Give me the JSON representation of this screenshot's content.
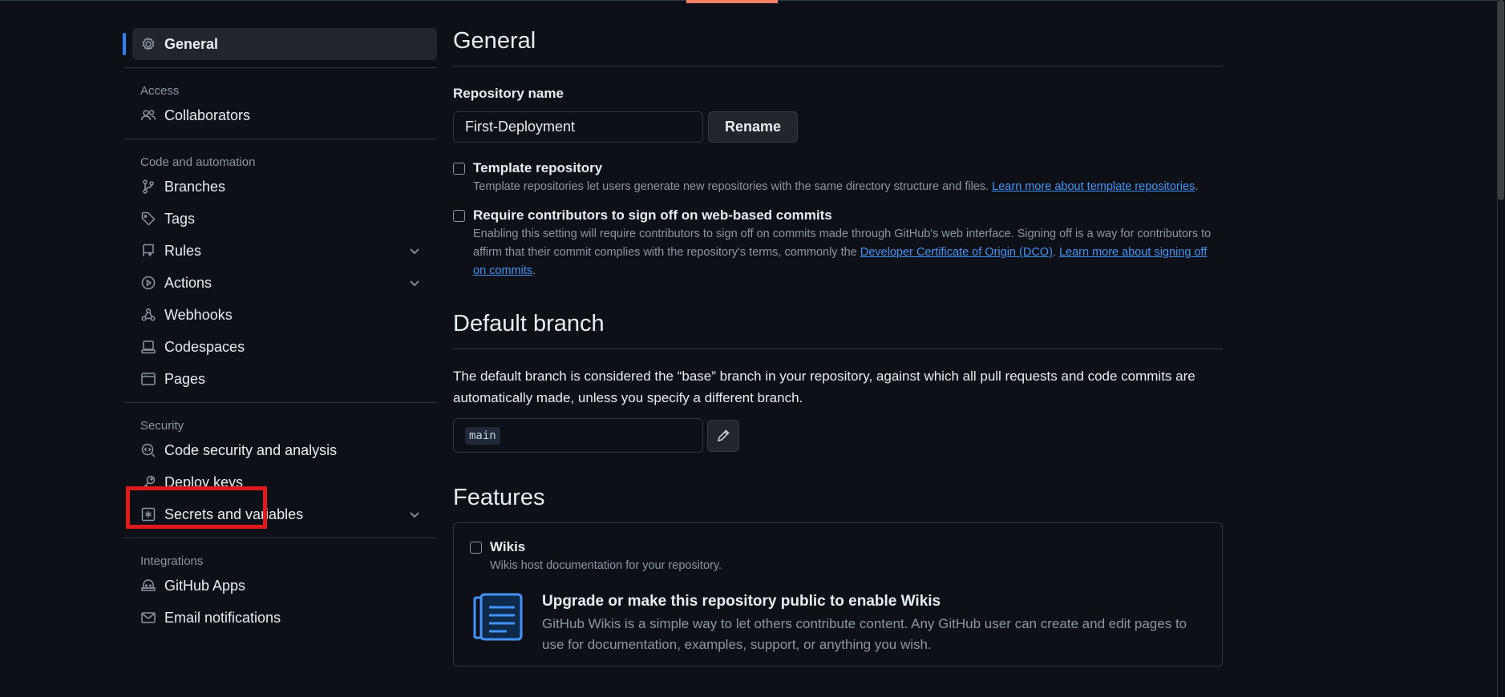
{
  "sidebar": {
    "general": "General",
    "access_heading": "Access",
    "collaborators": "Collaborators",
    "code_heading": "Code and automation",
    "branches": "Branches",
    "tags": "Tags",
    "rules": "Rules",
    "actions": "Actions",
    "webhooks": "Webhooks",
    "codespaces": "Codespaces",
    "pages": "Pages",
    "security_heading": "Security",
    "code_security": "Code security and analysis",
    "deploy_keys": "Deploy keys",
    "secrets": "Secrets and variables",
    "integrations_heading": "Integrations",
    "github_apps": "GitHub Apps",
    "email_notifications": "Email notifications"
  },
  "general": {
    "title": "General",
    "repo_name_label": "Repository name",
    "repo_name_value": "First-Deployment",
    "rename_button": "Rename",
    "template_title": "Template repository",
    "template_desc": "Template repositories let users generate new repositories with the same directory structure and files.",
    "template_link": "Learn more about template repositories",
    "signoff_title": "Require contributors to sign off on web-based commits",
    "signoff_desc_1": "Enabling this setting will require contributors to sign off on commits made through GitHub's web interface. Signing off is a way for contributors to affirm that their commit complies with the repository's terms, commonly the",
    "signoff_link_dco": "Developer Certificate of Origin (DCO)",
    "signoff_link_learn": "Learn more about signing off on commits"
  },
  "default_branch": {
    "title": "Default branch",
    "description": "The default branch is considered the “base” branch in your repository, against which all pull requests and code commits are automatically made, unless you specify a different branch.",
    "branch_value": "main"
  },
  "features": {
    "title": "Features",
    "wikis_title": "Wikis",
    "wikis_desc": "Wikis host documentation for your repository.",
    "upgrade_title": "Upgrade or make this repository public to enable Wikis",
    "upgrade_desc": "GitHub Wikis is a simple way to let others contribute content. Any GitHub user can create and edit pages to use for documentation, examples, support, or anything you wish."
  },
  "colors": {
    "background": "#0d1117",
    "accent": "#2f81f7",
    "link": "#4493f8",
    "highlight": "#e0191c"
  }
}
